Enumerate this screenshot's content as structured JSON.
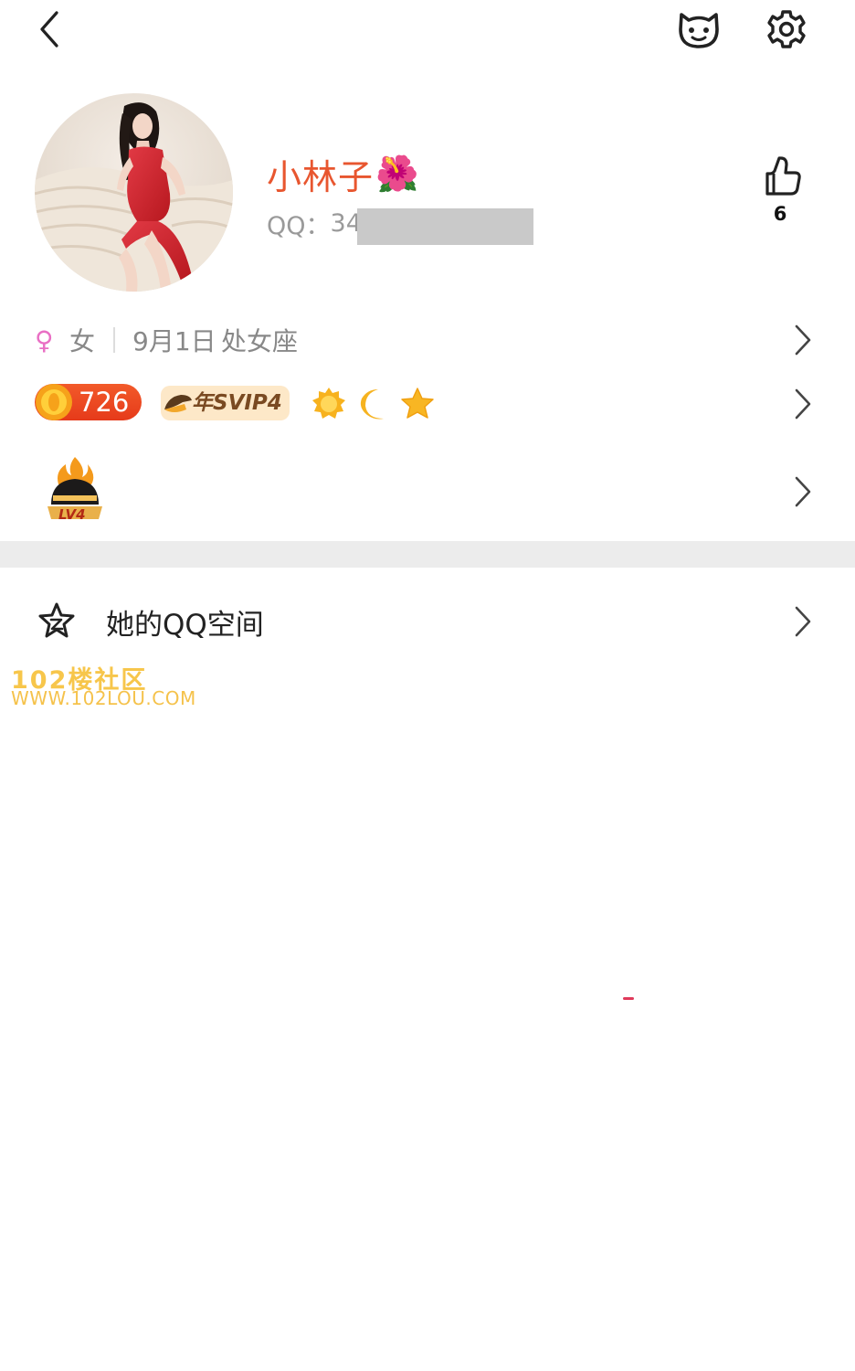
{
  "header": {
    "back_icon": "chevron-left-icon",
    "pet_icon": "cat-face-icon",
    "settings_icon": "gear-icon"
  },
  "profile": {
    "nickname": "小林子",
    "nickname_emoji": "🌺",
    "nickname_color": "#e8562f",
    "qq_label": "QQ：",
    "qq_visible_prefix": "34",
    "likes": "6"
  },
  "info": {
    "gender_symbol": "♀",
    "gender": "女",
    "birthday": "9月1日",
    "zodiac": "处女座"
  },
  "badges": {
    "coin_count": "726",
    "svip_label": "年SVIP4",
    "level_badge_text": "LV4"
  },
  "qzone": {
    "label": "她的QQ空间"
  },
  "watermark": {
    "title": "102楼社区",
    "url": "WWW.102LOU.COM"
  },
  "colors": {
    "accent": "#e8562f",
    "gender_pink": "#e96fc4",
    "divider": "#ececec"
  }
}
